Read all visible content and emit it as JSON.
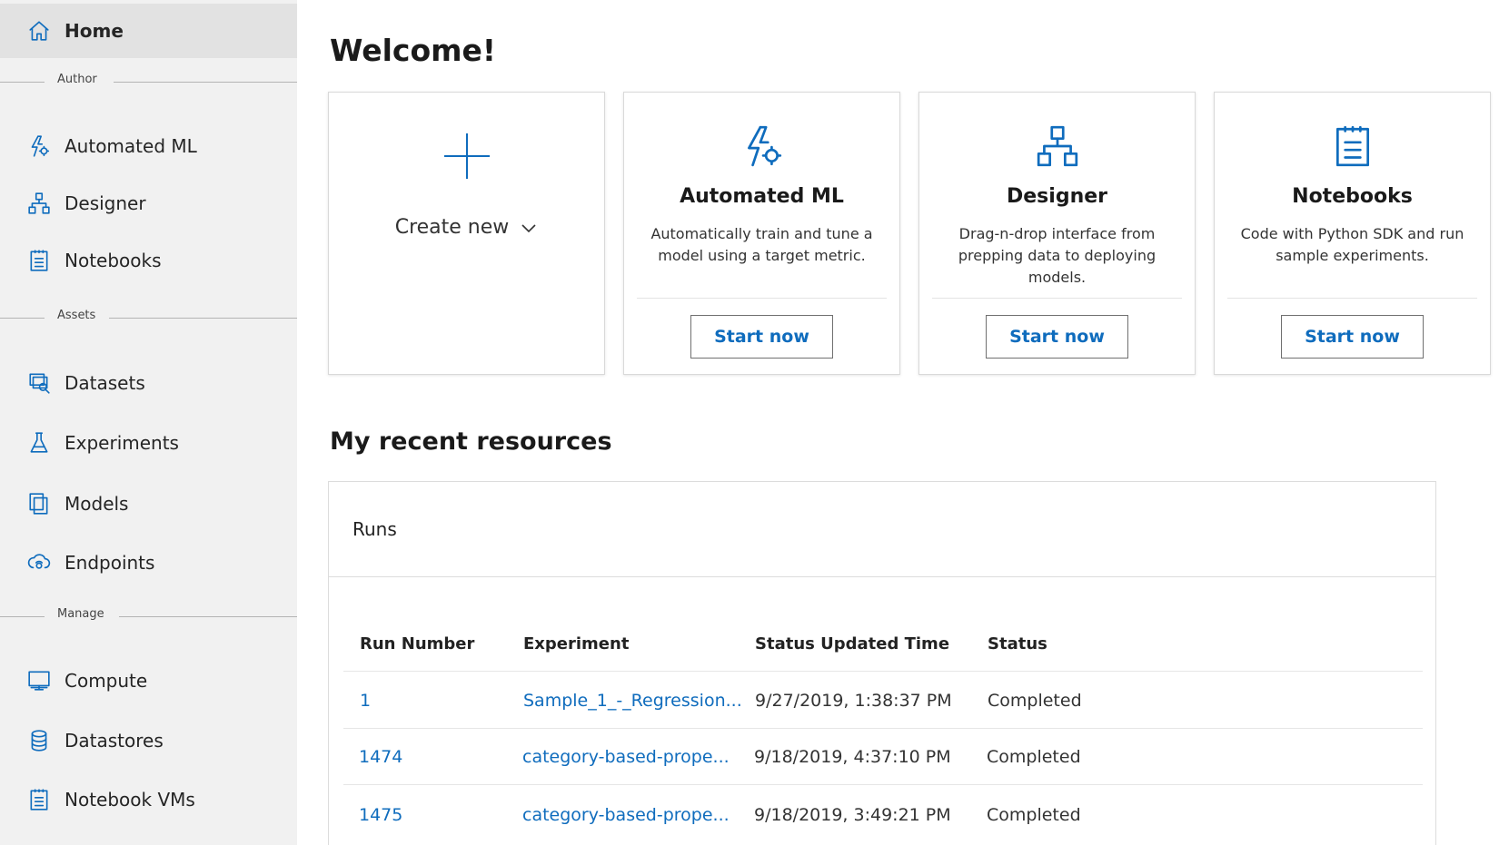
{
  "sidebar": {
    "home": {
      "label": "Home",
      "icon": "home-icon"
    },
    "sections": {
      "author": "Author",
      "assets": "Assets",
      "manage": "Manage"
    },
    "author_items": [
      {
        "label": "Automated ML",
        "icon": "automated-ml-icon"
      },
      {
        "label": "Designer",
        "icon": "designer-icon"
      },
      {
        "label": "Notebooks",
        "icon": "notebook-icon"
      }
    ],
    "assets_items": [
      {
        "label": "Datasets",
        "icon": "dataset-icon"
      },
      {
        "label": "Experiments",
        "icon": "flask-icon"
      },
      {
        "label": "Models",
        "icon": "models-icon"
      },
      {
        "label": "Endpoints",
        "icon": "endpoint-icon"
      }
    ],
    "manage_items": [
      {
        "label": "Compute",
        "icon": "monitor-icon"
      },
      {
        "label": "Datastores",
        "icon": "database-icon"
      },
      {
        "label": "Notebook VMs",
        "icon": "notebook-icon"
      }
    ]
  },
  "main": {
    "welcome_title": "Welcome!",
    "create_new": {
      "label": "Create new",
      "icon": "plus-icon"
    },
    "cards": [
      {
        "title": "Automated ML",
        "description": "Automatically train and tune a model using a target metric.",
        "button": "Start now",
        "icon": "automated-ml-icon"
      },
      {
        "title": "Designer",
        "description": "Drag-n-drop interface from prepping data to deploying models.",
        "button": "Start now",
        "icon": "designer-icon"
      },
      {
        "title": "Notebooks",
        "description": "Code with Python SDK and run sample experiments.",
        "button": "Start now",
        "icon": "notebook-icon"
      }
    ],
    "recent_title": "My recent resources",
    "runs": {
      "title": "Runs",
      "columns": [
        "Run Number",
        "Experiment",
        "Status Updated Time",
        "Status"
      ],
      "rows": [
        {
          "run": "1",
          "experiment": "Sample_1_-_Regression...",
          "time": "9/27/2019, 1:38:37 PM",
          "status": "Completed"
        },
        {
          "run": "1474",
          "experiment": "category-based-prope...",
          "time": "9/18/2019, 4:37:10 PM",
          "status": "Completed"
        },
        {
          "run": "1475",
          "experiment": "category-based-prope...",
          "time": "9/18/2019, 3:49:21 PM",
          "status": "Completed"
        }
      ]
    }
  },
  "colors": {
    "accent": "#0f6cbd",
    "sidebar_bg": "#f1f1f1",
    "active_bg": "#e2e2e2"
  }
}
